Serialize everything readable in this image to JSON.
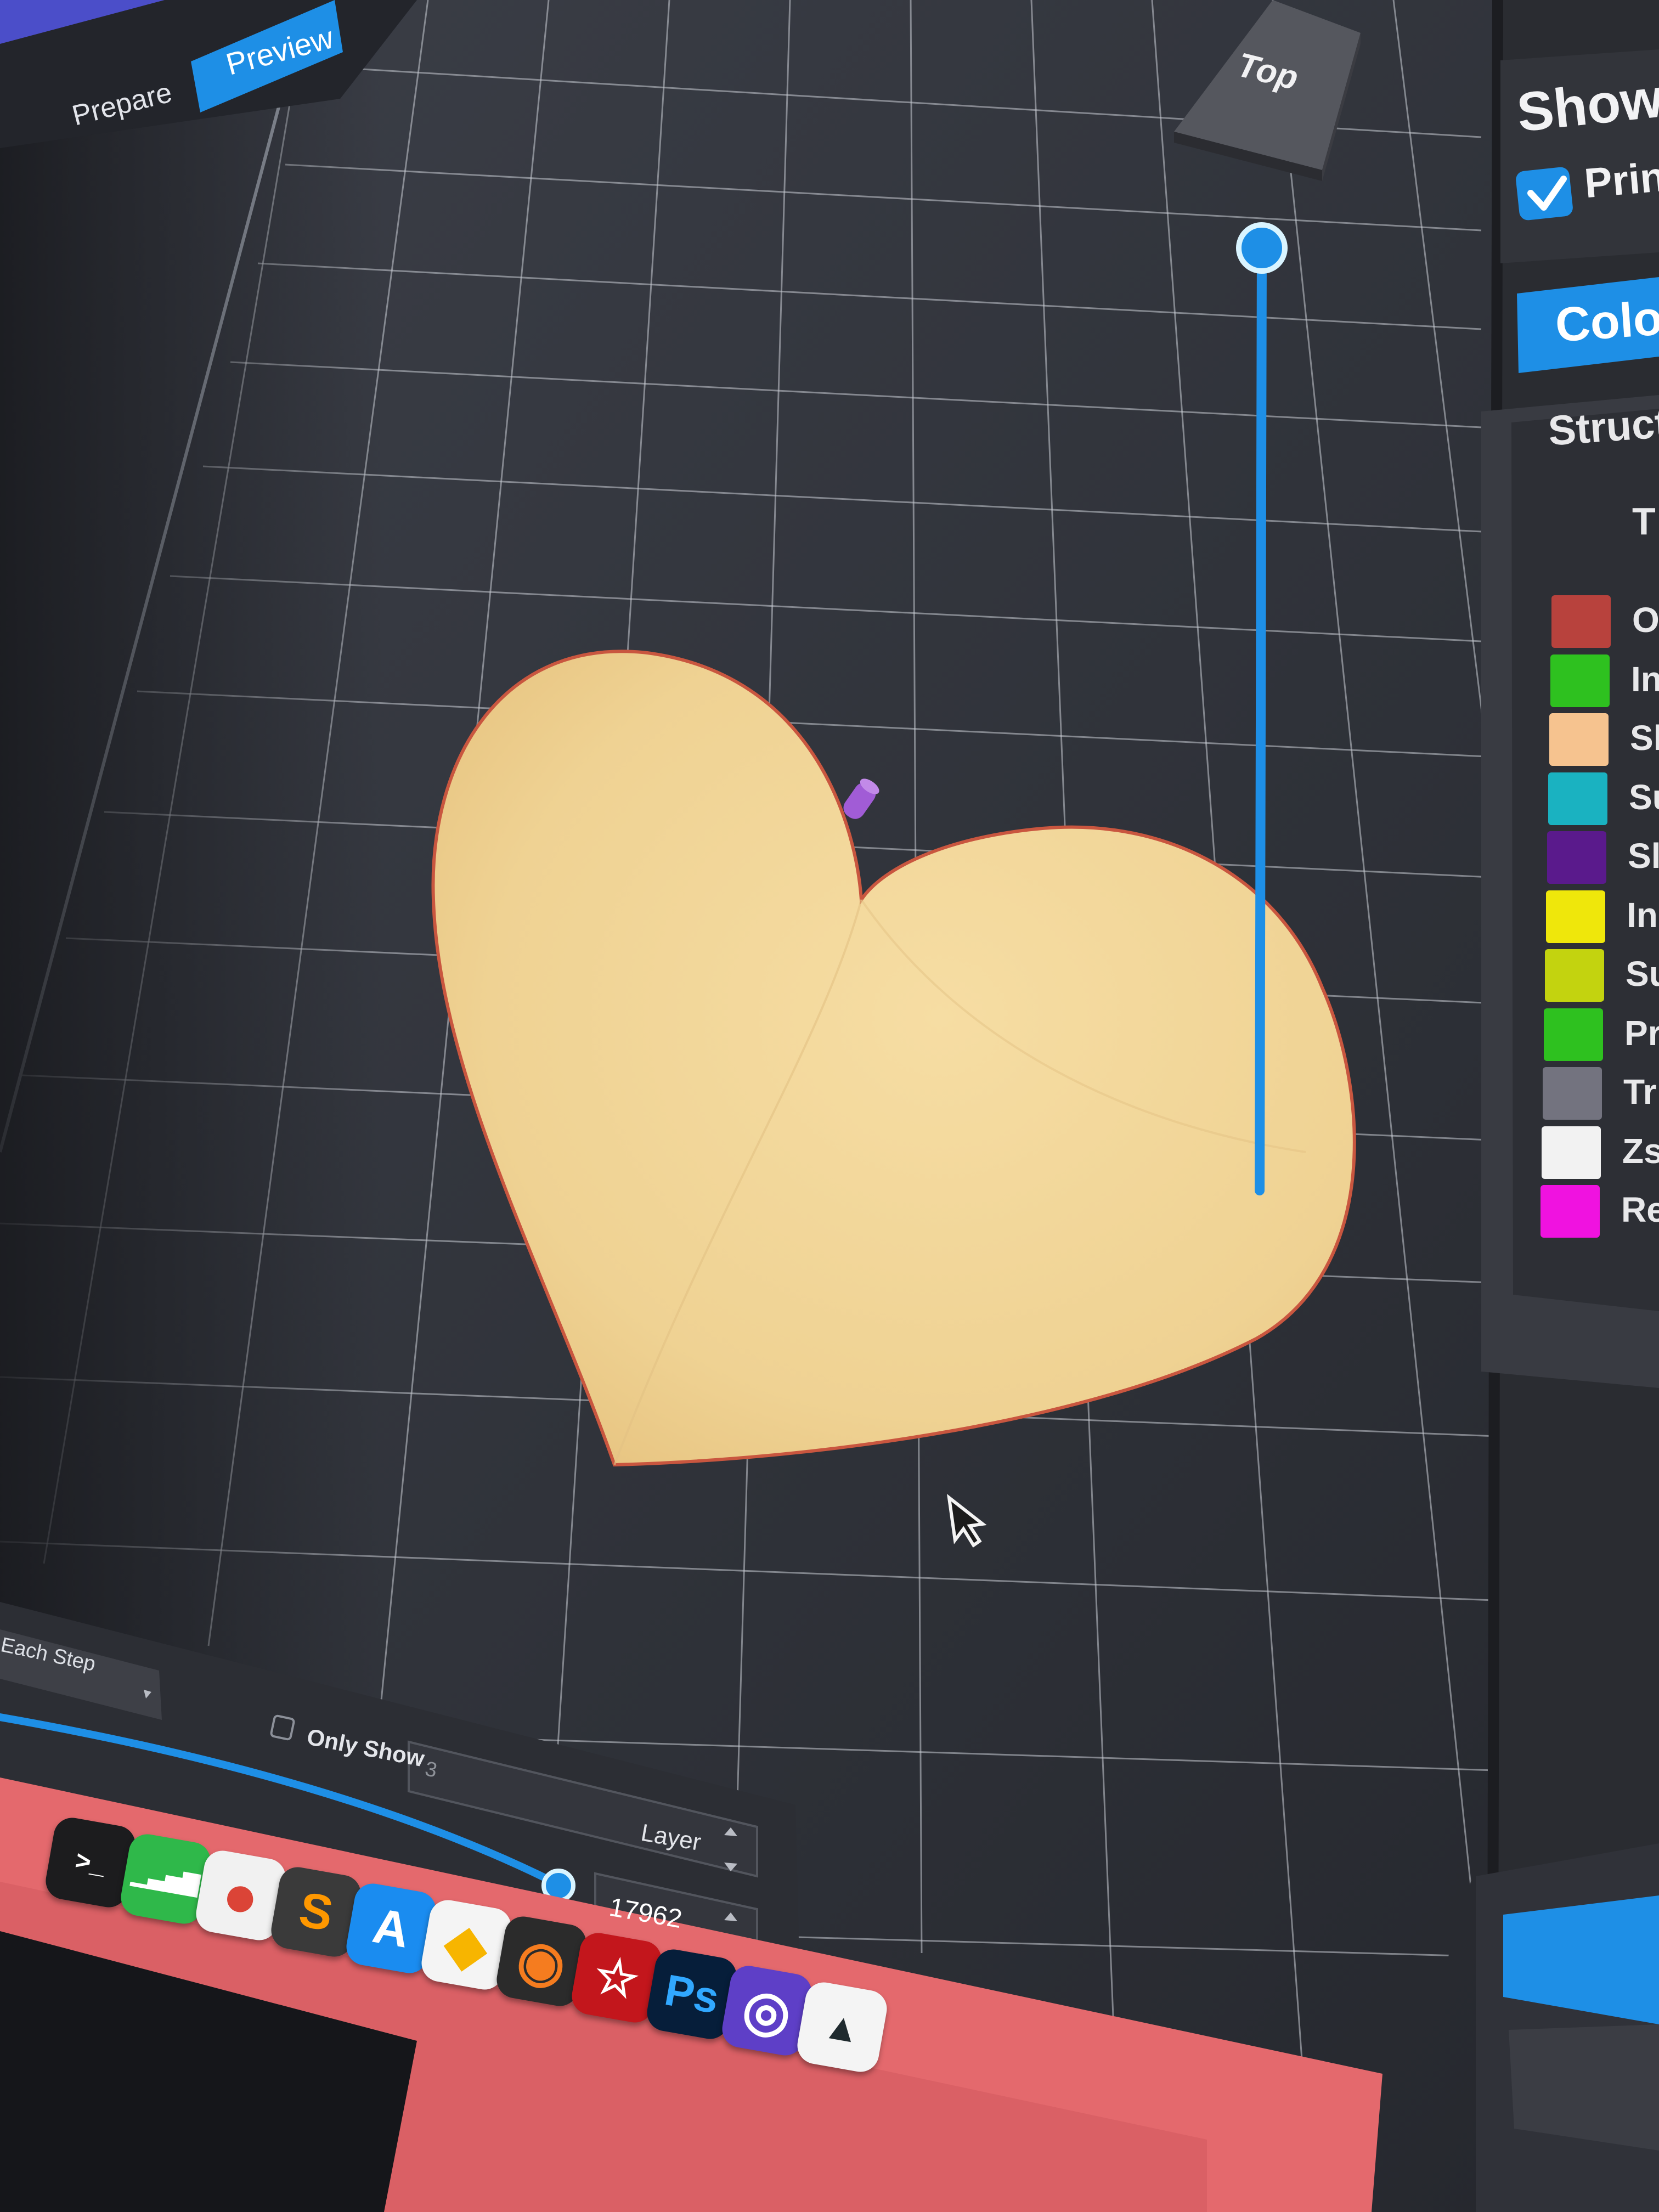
{
  "app": {
    "tabs": [
      {
        "label": "Prepare"
      },
      {
        "label": "Preview"
      }
    ],
    "view_cube_label": "Top"
  },
  "sidebar": {
    "show_heading": "Show",
    "print_checkbox_label": "Prin",
    "color_scheme_button": "Colo",
    "legend_header": "Struct",
    "legend_subheader": "T",
    "legend_items": [
      {
        "label": "O",
        "color": "#b8423d"
      },
      {
        "label": "In",
        "color": "#2ec11f"
      },
      {
        "label": "Sl",
        "color": "#f6c38f"
      },
      {
        "label": "Su",
        "color": "#1ab2c1"
      },
      {
        "label": "Sl",
        "color": "#5a1a8c"
      },
      {
        "label": "In",
        "color": "#efe70b"
      },
      {
        "label": "Su",
        "color": "#c3d30f"
      },
      {
        "label": "Pr",
        "color": "#2ec11f"
      },
      {
        "label": "Tr",
        "color": "#73737f"
      },
      {
        "label": "Zs",
        "color": "#f2f2f2"
      },
      {
        "label": "Re",
        "color": "#f012e0"
      }
    ]
  },
  "bottom_panel": {
    "step_dropdown": "Each Step",
    "only_show_label": "Only Show",
    "only_show_value": "3",
    "layer_label": "Layer",
    "layer_value": "17962"
  },
  "dock": {
    "items": [
      {
        "label": "",
        "icon": "terminal-icon"
      },
      {
        "label": "",
        "icon": "numbers-icon"
      },
      {
        "label": "",
        "icon": "chrome-icon"
      },
      {
        "label": "S",
        "icon": "sublime-text-icon"
      },
      {
        "label": "",
        "icon": "app-store-icon"
      },
      {
        "label": "",
        "icon": "sketch-icon"
      },
      {
        "label": "",
        "icon": "blender-icon"
      },
      {
        "label": "",
        "icon": "acrobat-icon"
      },
      {
        "label": "Ps",
        "icon": "photoshop-icon"
      },
      {
        "label": "",
        "icon": "github-desktop-icon"
      },
      {
        "label": "",
        "icon": "bird-app-icon"
      }
    ]
  },
  "colors": {
    "accent_blue": "#1e8fe6",
    "viewport_bg": "#34373f",
    "model_fill": "#f0d597",
    "model_edge": "#d06a52",
    "dock_bg": "#e4696d"
  }
}
